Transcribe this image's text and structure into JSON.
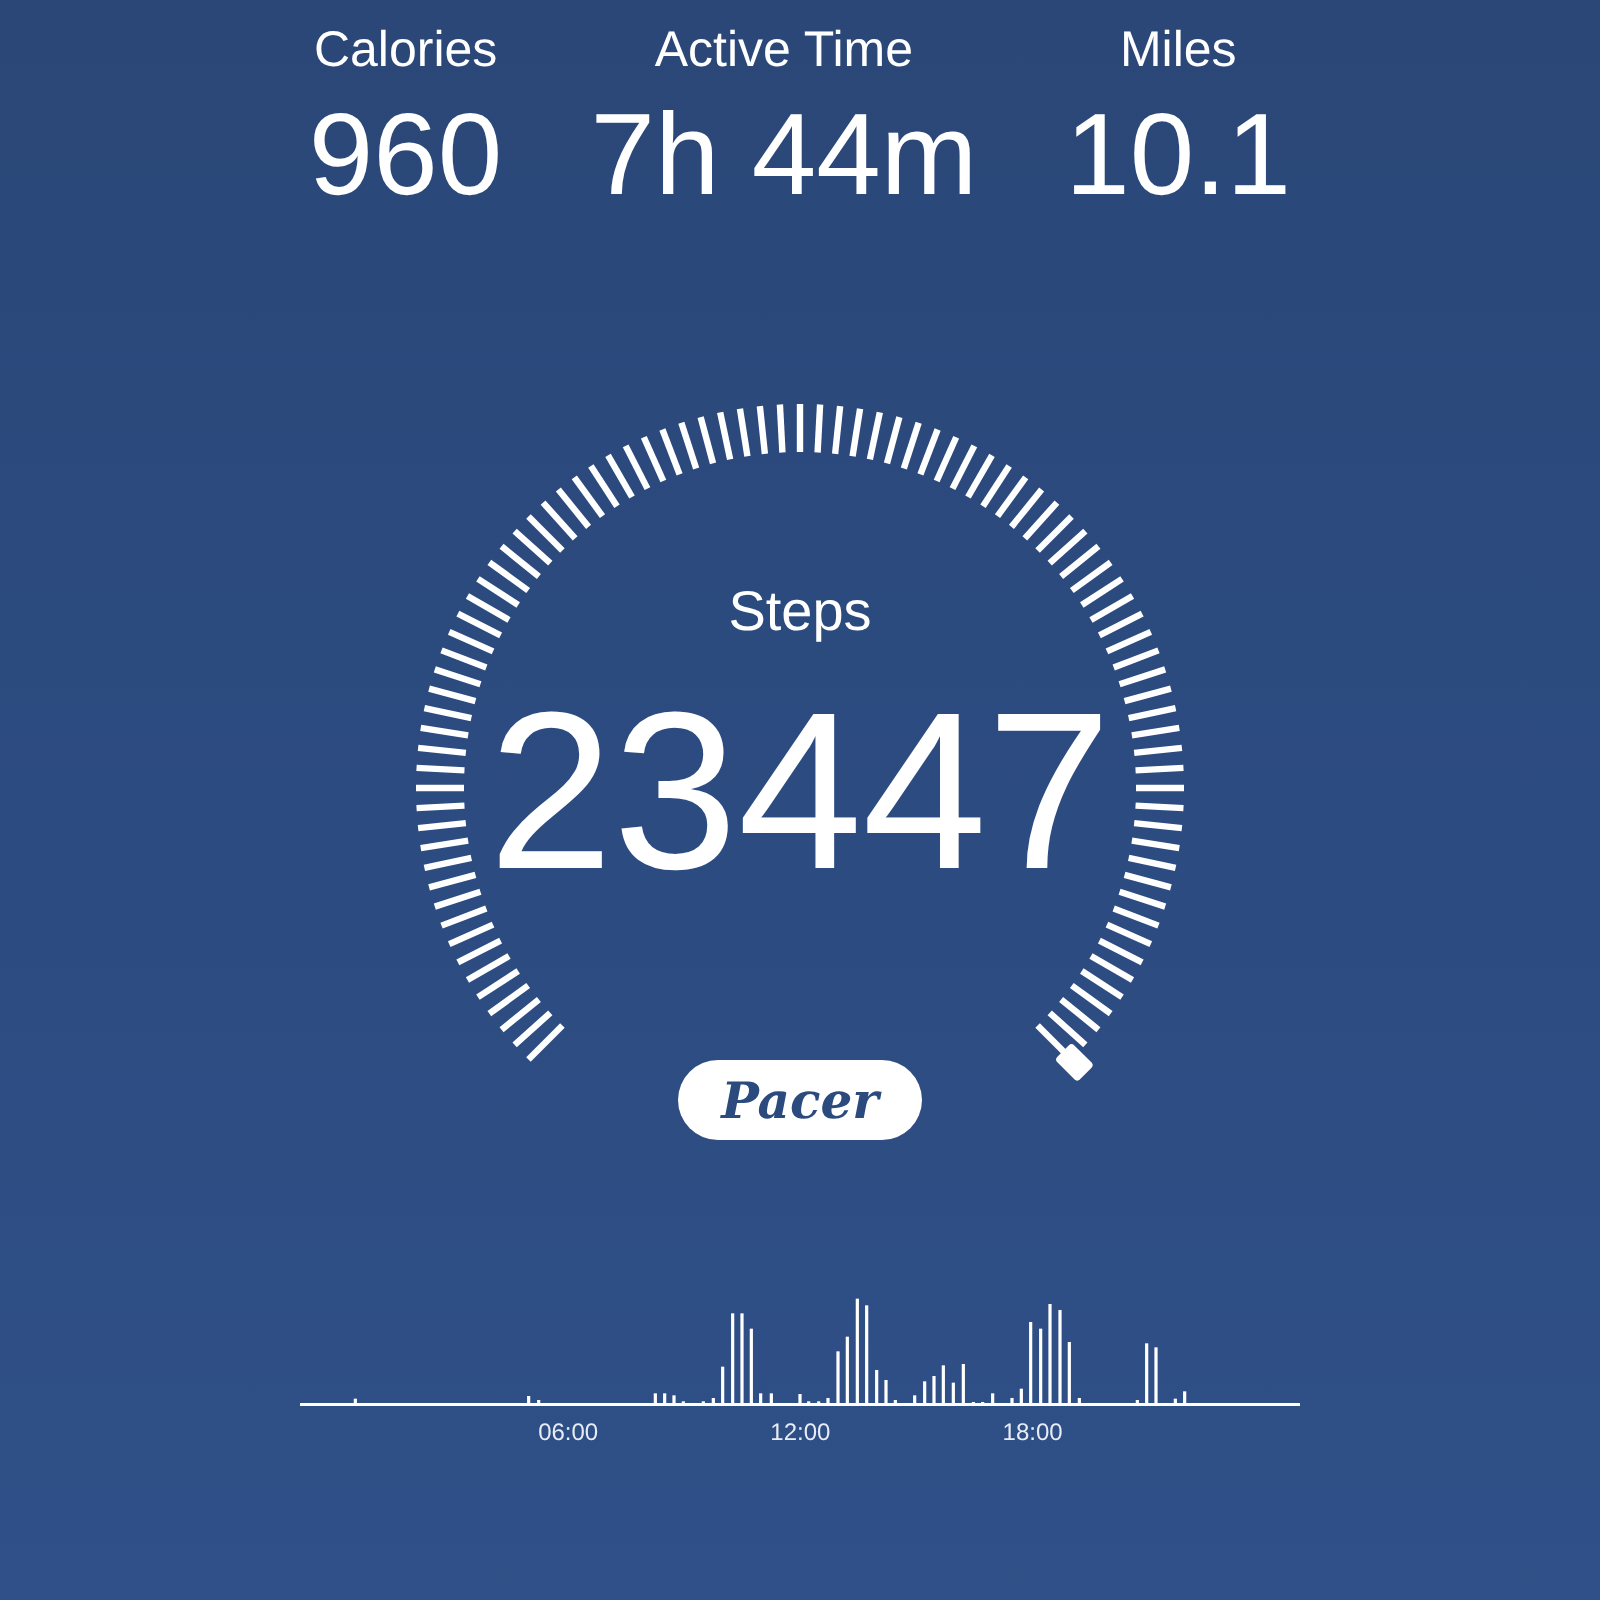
{
  "stats": [
    {
      "label": "Calories",
      "value": "960"
    },
    {
      "label": "Active Time",
      "value": "7h 44m"
    },
    {
      "label": "Miles",
      "value": "10.1"
    }
  ],
  "gauge": {
    "label": "Steps",
    "value": "23447"
  },
  "brand": {
    "logo": "Pacer"
  },
  "activity": {
    "time_labels": [
      "06:00",
      "12:00",
      "18:00"
    ]
  }
}
